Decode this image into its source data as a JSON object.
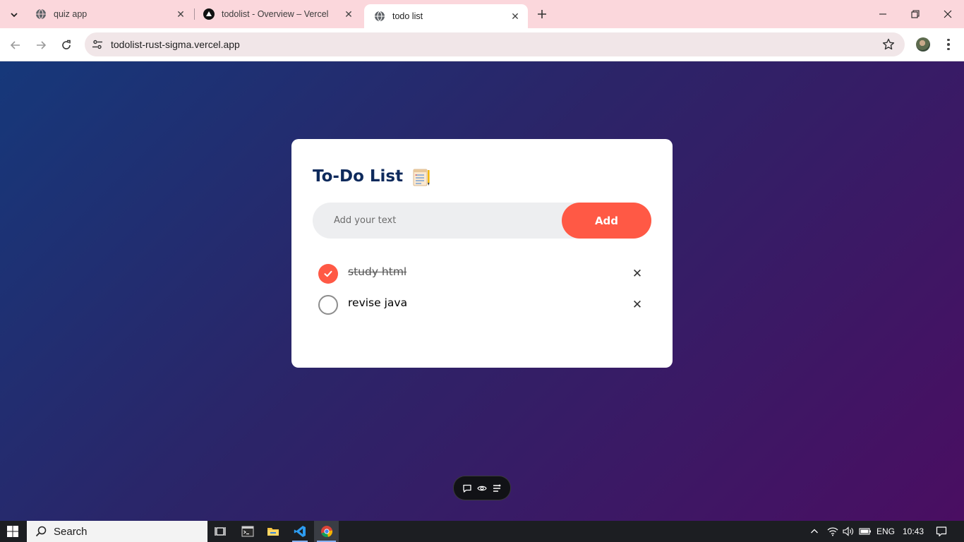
{
  "browser": {
    "tabs": [
      {
        "title": "quiz app",
        "active": false,
        "icon": "globe-icon"
      },
      {
        "title": "todolist - Overview – Vercel",
        "active": false,
        "icon": "vercel-icon"
      },
      {
        "title": "todo list",
        "active": true,
        "icon": "globe-icon"
      }
    ],
    "address": "todolist-rust-sigma.vercel.app"
  },
  "app": {
    "title": "To-Do List",
    "input_placeholder": "Add your text",
    "add_label": "Add",
    "todos": [
      {
        "text": "study html",
        "done": true
      },
      {
        "text": "revise java",
        "done": false
      }
    ],
    "accent_color": "#ff5945",
    "title_color": "#0e2a5c"
  },
  "taskbar": {
    "search_label": "Search",
    "language": "ENG",
    "time": "10:43"
  }
}
